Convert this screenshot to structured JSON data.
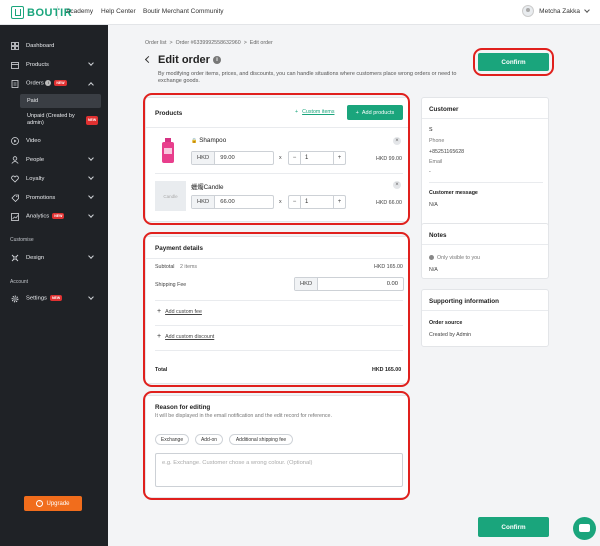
{
  "topbar": {
    "logo": "BOUTIR",
    "links": [
      "Academy",
      "Help Center",
      "Boutir Merchant Community"
    ],
    "user_name": "Metcha Zakka"
  },
  "sidebar": {
    "items": [
      {
        "label": "Dashboard",
        "icon": "dashboard-icon"
      },
      {
        "label": "Products",
        "icon": "box-icon"
      },
      {
        "label": "Orders",
        "icon": "orders-icon",
        "badge": "NEW"
      },
      {
        "label": "Video",
        "icon": "play-icon"
      },
      {
        "label": "People",
        "icon": "people-icon"
      },
      {
        "label": "Loyalty",
        "icon": "heart-icon"
      },
      {
        "label": "Promotions",
        "icon": "percent-icon"
      },
      {
        "label": "Analytics",
        "icon": "analytics-icon",
        "badge": "NEW"
      }
    ],
    "order_sub": [
      "Paid",
      "Unpaid (Created by admin)"
    ],
    "sections": [
      "Customise",
      "Account"
    ],
    "design_label": "Design",
    "settings_label": "Settings",
    "settings_badge": "NEW",
    "unpaid_badge": "NEW",
    "upgrade_label": "Upgrade"
  },
  "header": {
    "breadcrumb": [
      "Order list",
      ">",
      "Order #6339992558632960",
      ">",
      "Edit order"
    ],
    "title": "Edit order",
    "description": "By modifying order items, prices, and discounts, you can handle situations where customers place wrong orders or need to exchange goods.",
    "confirm_label": "Confirm"
  },
  "products": {
    "title": "Products",
    "custom_items_label": "Custom items",
    "add_products_label": "Add products",
    "items": [
      {
        "name": "Shampoo",
        "currency": "HKD",
        "price": "99.00",
        "qty": "1",
        "total": "HKD 99.00",
        "thumb_text": ""
      },
      {
        "name": "蠟燭Candle",
        "currency": "HKD",
        "price": "66.00",
        "qty": "1",
        "total": "HKD 66.00",
        "thumb_text": "Candle"
      }
    ],
    "times": "x"
  },
  "payment": {
    "title": "Payment details",
    "subtotal_label": "Subtotal",
    "subtotal_items": "2 items",
    "subtotal_value": "HKD 165.00",
    "shipping_label": "Shipping Fee",
    "shipping_currency": "HKD",
    "shipping_value": "0.00",
    "add_fee_label": "Add custom fee",
    "add_discount_label": "Add custom discount",
    "total_label": "Total",
    "total_value": "HKD 165.00"
  },
  "reason": {
    "title": "Reason for editing",
    "subtitle": "It will be displayed in the email notification and the edit record for reference.",
    "chips": [
      "Exchange",
      "Add-on",
      "Additional shipping fee"
    ],
    "placeholder": "e.g. Exchange. Customer chose a wrong colour. (Optional)"
  },
  "customer": {
    "title": "Customer",
    "name": "S",
    "phone_label": "Phone",
    "phone": "+85251165628",
    "email_label": "Email",
    "email": "-",
    "message_label": "Customer message",
    "message": "N/A"
  },
  "notes": {
    "title": "Notes",
    "visibility": "Only visible to you",
    "value": "N/A"
  },
  "supporting": {
    "title": "Supporting information",
    "source_label": "Order source",
    "source_value": "Created by Admin"
  },
  "footer": {
    "confirm_label": "Confirm"
  },
  "colors": {
    "accent": "#1aa57c",
    "highlight": "#e0201d",
    "sidebar": "#1f2226",
    "upgrade": "#f16d1c"
  }
}
